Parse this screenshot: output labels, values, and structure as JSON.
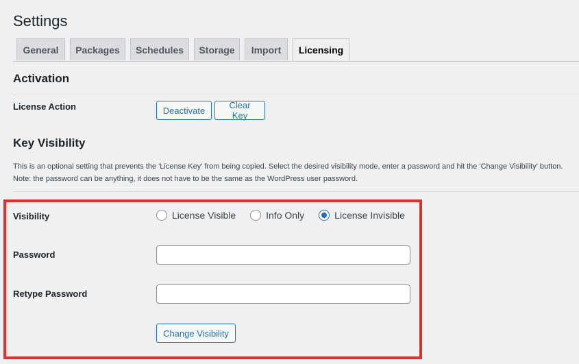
{
  "page": {
    "title": "Settings"
  },
  "tabs": [
    {
      "label": "General",
      "active": false
    },
    {
      "label": "Packages",
      "active": false
    },
    {
      "label": "Schedules",
      "active": false
    },
    {
      "label": "Storage",
      "active": false
    },
    {
      "label": "Import",
      "active": false
    },
    {
      "label": "Licensing",
      "active": true
    }
  ],
  "activation": {
    "heading": "Activation",
    "license_action_label": "License Action",
    "deactivate_label": "Deactivate",
    "clear_key_label": "Clear Key"
  },
  "key_visibility": {
    "heading": "Key Visibility",
    "description_line1": "This is an optional setting that prevents the 'License Key' from being copied. Select the desired visibility mode, enter a password and hit the 'Change Visibility' button.",
    "description_line2": "Note: the password can be anything, it does not have to be the same as the WordPress user password.",
    "visibility_label": "Visibility",
    "options": [
      {
        "label": "License Visible",
        "checked": false
      },
      {
        "label": "Info Only",
        "checked": false
      },
      {
        "label": "License Invisible",
        "checked": true
      }
    ],
    "password_label": "Password",
    "password_value": "",
    "retype_password_label": "Retype Password",
    "retype_password_value": "",
    "change_visibility_label": "Change Visibility"
  },
  "colors": {
    "accent": "#2271b1",
    "highlight": "#e12f2f",
    "background": "#f0f0f1"
  }
}
